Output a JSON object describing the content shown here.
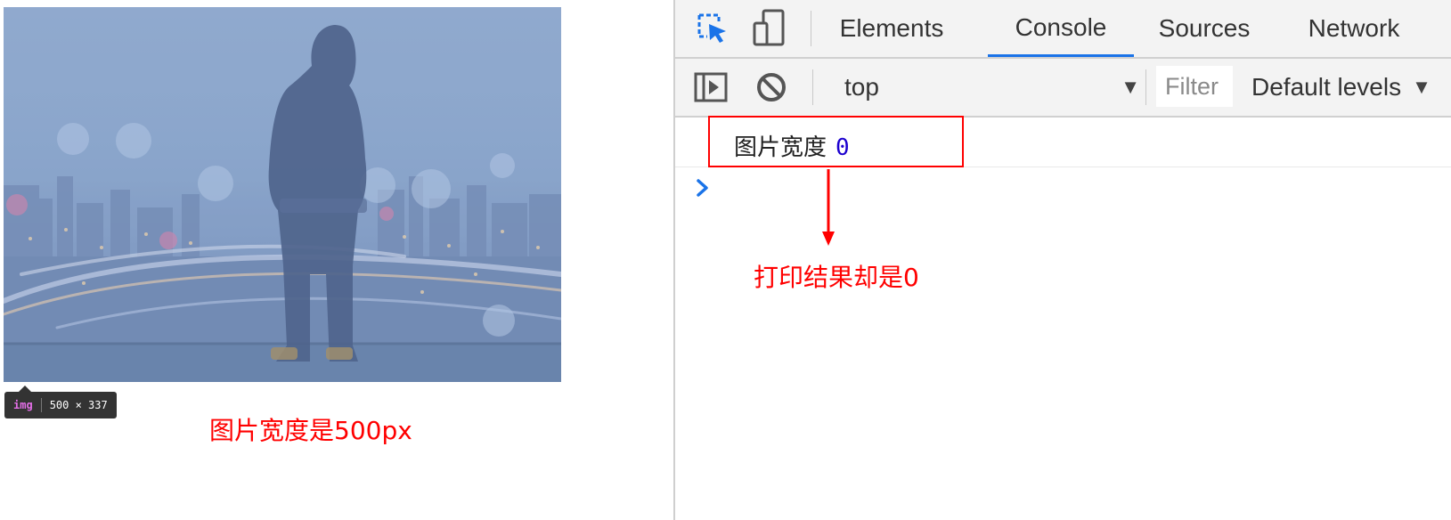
{
  "page": {
    "tooltip": {
      "tag": "img",
      "size": "500 × 337"
    },
    "width_note": "图片宽度是500px"
  },
  "devtools": {
    "tabs": [
      {
        "label": "Elements",
        "active": false
      },
      {
        "label": "Console",
        "active": true
      },
      {
        "label": "Sources",
        "active": false
      },
      {
        "label": "Network",
        "active": false
      }
    ],
    "toolbar": {
      "context": "top",
      "filter_placeholder": "Filter",
      "levels": "Default levels"
    },
    "console": {
      "log_label": "图片宽度",
      "log_value": "0"
    },
    "annotation": "打印结果却是0"
  },
  "colors": {
    "accent_blue": "#1a73e8",
    "annotation_red": "#ff0000",
    "console_number": "#1c00cf"
  },
  "icons": [
    "inspect-element-icon",
    "device-toolbar-icon",
    "sidebar-toggle-icon",
    "clear-console-icon",
    "dropdown-triangle-icon",
    "prompt-chevron-icon"
  ]
}
